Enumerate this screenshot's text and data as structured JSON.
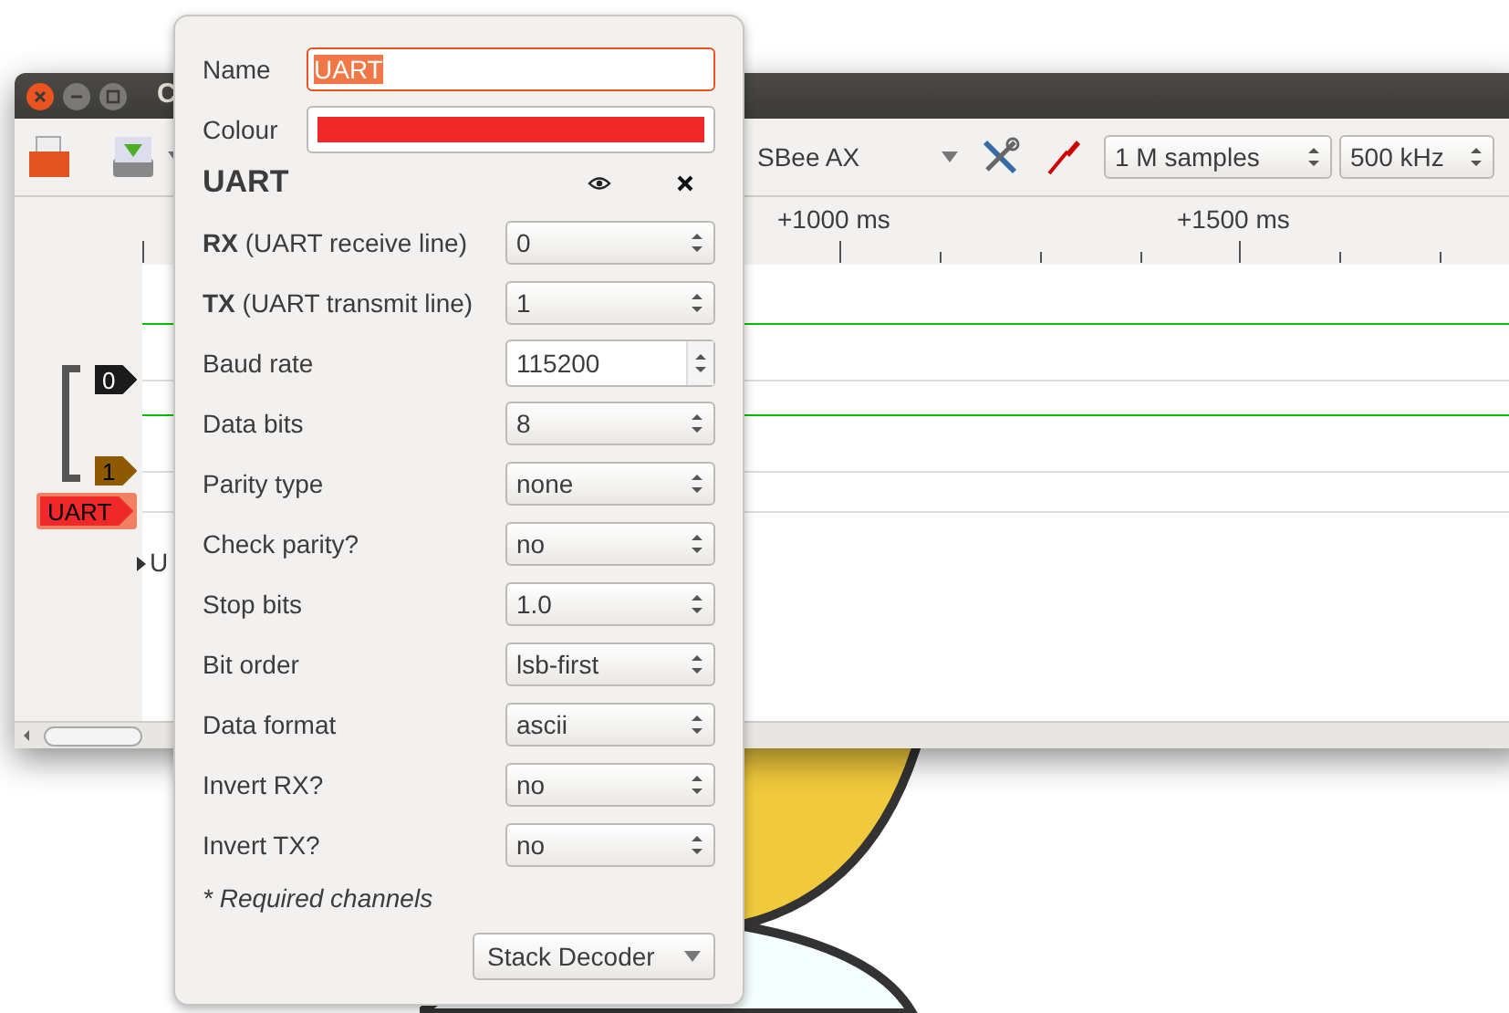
{
  "window": {
    "title": "C"
  },
  "toolbar": {
    "device": "SBee AX",
    "samples": "1 M samples",
    "rate": "500 kHz"
  },
  "ruler": {
    "labels": [
      "+1000 ms",
      "+1500 ms"
    ]
  },
  "channels": [
    {
      "label": "0",
      "color": "#1a1a1a"
    },
    {
      "label": "1",
      "color": "#8f5902"
    }
  ],
  "decoder_tag": {
    "label": "UART",
    "color": "#ef2929"
  },
  "decoder_row": {
    "label": "U",
    "expanded": false
  },
  "popup": {
    "name_label": "Name",
    "name": "UART",
    "colour_label": "Colour",
    "color": "#ef2929",
    "title": "UART",
    "fields": [
      {
        "label": "**RX** (UART receive line)",
        "value": "0",
        "kind": "combo"
      },
      {
        "label": "**TX** (UART transmit line)",
        "value": "1",
        "kind": "combo"
      },
      {
        "label": "Baud rate",
        "value": "115200",
        "kind": "entry"
      },
      {
        "label": "Data bits",
        "value": "8",
        "kind": "combo"
      },
      {
        "label": "Parity type",
        "value": "none",
        "kind": "combo"
      },
      {
        "label": "Check parity?",
        "value": "no",
        "kind": "combo"
      },
      {
        "label": "Stop bits",
        "value": "1.0",
        "kind": "combo"
      },
      {
        "label": "Bit order",
        "value": "lsb-first",
        "kind": "combo"
      },
      {
        "label": "Data format",
        "value": "ascii",
        "kind": "combo"
      },
      {
        "label": "Invert RX?",
        "value": "no",
        "kind": "combo"
      },
      {
        "label": "Invert TX?",
        "value": "no",
        "kind": "combo"
      }
    ],
    "note": "* Required channels",
    "button": "Stack Decoder"
  }
}
